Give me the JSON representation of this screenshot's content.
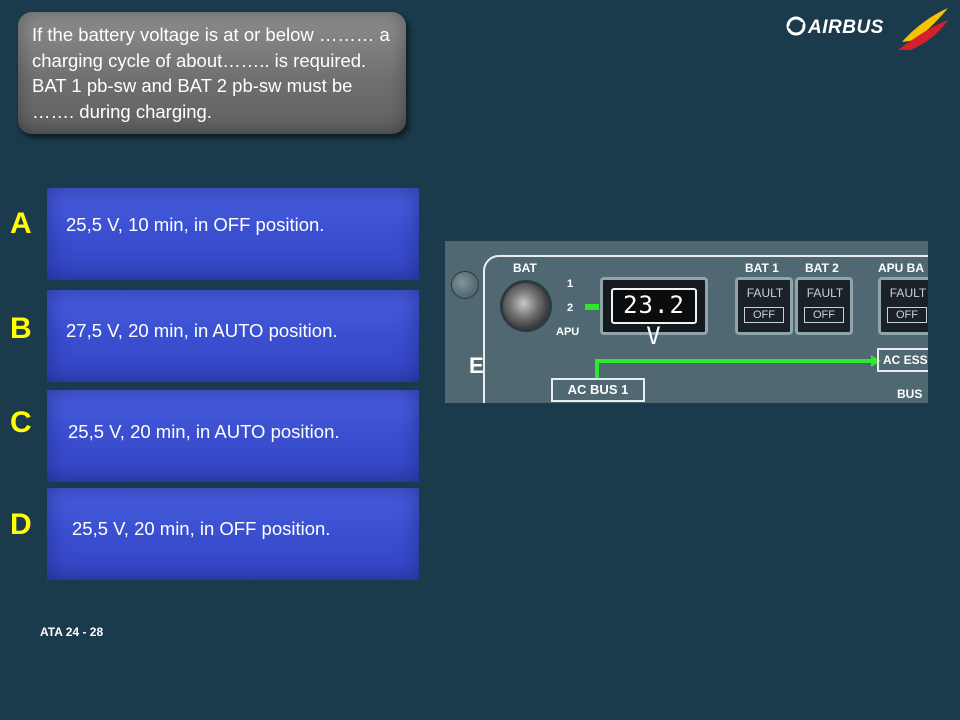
{
  "question": {
    "text": "If the battery voltage is at or below ……… a charging cycle of about…….. is required. BAT 1 pb-sw and BAT 2 pb-sw must be ……. during charging."
  },
  "logo": {
    "text": "AIRBUS",
    "colors": {
      "wing_top": "#f4c400",
      "wing_bottom": "#d4202c"
    }
  },
  "options": [
    {
      "letter": "A",
      "text": "25,5 V, 10 min, in OFF position."
    },
    {
      "letter": "B",
      "text": "27,5 V, 20 min, in AUTO position."
    },
    {
      "letter": "C",
      "text": "25,5 V, 20 min, in AUTO position."
    },
    {
      "letter": "D",
      "text": "25,5 V, 20 min, in OFF position."
    }
  ],
  "panel": {
    "bat_label": "BAT",
    "sel_1": "1",
    "sel_2": "2",
    "apu_label": "APU",
    "voltage": "23.2 V",
    "bat1_label": "BAT 1",
    "bat2_label": "BAT 2",
    "apu_bat_label": "APU BA",
    "fault": "FAULT",
    "off": "OFF",
    "ac_bus_1": "AC BUS 1",
    "ac_ess": "AC ESS",
    "bus": "BUS",
    "side_letter": "E",
    "colors": {
      "green_line": "#2ee82e",
      "panel_bg": "#4f6872"
    }
  },
  "footer": {
    "text": "ATA 24 - 28"
  },
  "colors": {
    "background": "#1b3a4b",
    "option_blue": "#3f54d6",
    "letter_yellow": "#ffff00"
  }
}
